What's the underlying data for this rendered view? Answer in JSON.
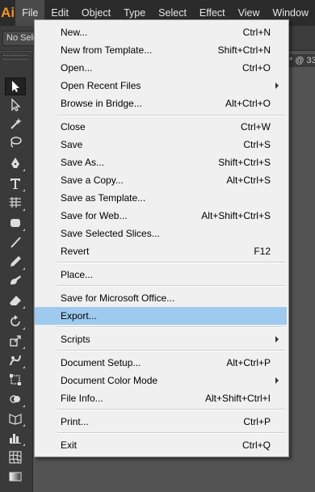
{
  "app": {
    "logo": "Ai",
    "brand_color": "#f7941d"
  },
  "menubar": {
    "items": [
      {
        "label": "File",
        "active": true
      },
      {
        "label": "Edit"
      },
      {
        "label": "Object"
      },
      {
        "label": "Type"
      },
      {
        "label": "Select"
      },
      {
        "label": "Effect"
      },
      {
        "label": "View"
      },
      {
        "label": "Window"
      }
    ]
  },
  "controlbar": {
    "selection_label": "No Selection"
  },
  "document_tab": {
    "label": "* @ 33"
  },
  "tools": [
    "selection-tool",
    "direct-selection-tool",
    "magic-wand-tool",
    "lasso-tool",
    "pen-tool",
    "type-tool",
    "line-segment-tool",
    "rectangle-tool",
    "paintbrush-tool",
    "pencil-tool",
    "blob-brush-tool",
    "eraser-tool",
    "rotate-tool",
    "scale-tool",
    "warp-tool",
    "free-transform-tool",
    "shape-builder-tool",
    "perspective-grid-tool",
    "column-graph-tool",
    "mesh-tool",
    "gradient-tool"
  ],
  "file_menu": {
    "items": [
      {
        "label": "New...",
        "shortcut": "Ctrl+N"
      },
      {
        "label": "New from Template...",
        "shortcut": "Shift+Ctrl+N"
      },
      {
        "label": "Open...",
        "shortcut": "Ctrl+O"
      },
      {
        "label": "Open Recent Files",
        "shortcut": "",
        "submenu": true
      },
      {
        "label": "Browse in Bridge...",
        "shortcut": "Alt+Ctrl+O"
      },
      {
        "label": "Close",
        "shortcut": "Ctrl+W"
      },
      {
        "label": "Save",
        "shortcut": "Ctrl+S"
      },
      {
        "label": "Save As...",
        "shortcut": "Shift+Ctrl+S"
      },
      {
        "label": "Save a Copy...",
        "shortcut": "Alt+Ctrl+S"
      },
      {
        "label": "Save as Template...",
        "shortcut": ""
      },
      {
        "label": "Save for Web...",
        "shortcut": "Alt+Shift+Ctrl+S"
      },
      {
        "label": "Save Selected Slices...",
        "shortcut": ""
      },
      {
        "label": "Revert",
        "shortcut": "F12"
      },
      {
        "label": "Place...",
        "shortcut": ""
      },
      {
        "label": "Save for Microsoft Office...",
        "shortcut": ""
      },
      {
        "label": "Export...",
        "shortcut": "",
        "highlighted": true
      },
      {
        "label": "Scripts",
        "shortcut": "",
        "submenu": true
      },
      {
        "label": "Document Setup...",
        "shortcut": "Alt+Ctrl+P"
      },
      {
        "label": "Document Color Mode",
        "shortcut": "",
        "submenu": true
      },
      {
        "label": "File Info...",
        "shortcut": "Alt+Shift+Ctrl+I"
      },
      {
        "label": "Print...",
        "shortcut": "Ctrl+P"
      },
      {
        "label": "Exit",
        "shortcut": "Ctrl+Q"
      }
    ]
  }
}
